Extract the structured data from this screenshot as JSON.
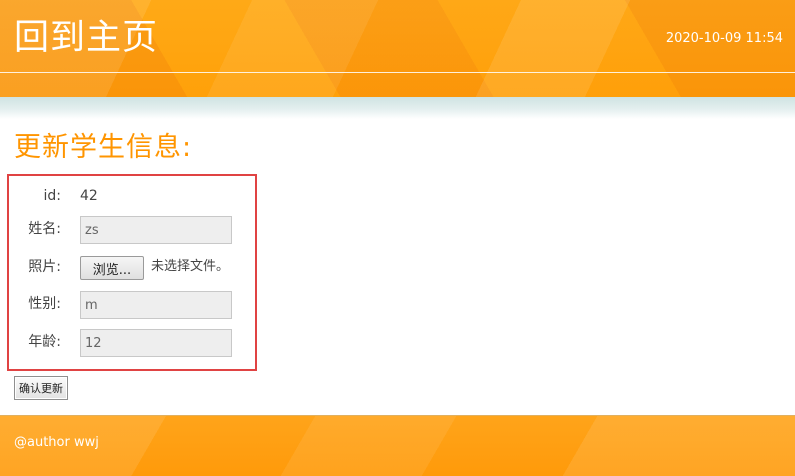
{
  "header": {
    "home_link": "回到主页",
    "datetime": "2020-10-09 11:54"
  },
  "page": {
    "title": "更新学生信息:"
  },
  "form": {
    "id_label": "id:",
    "id_value": "42",
    "name_label": "姓名:",
    "name_value": "zs",
    "photo_label": "照片:",
    "photo_button": "浏览...",
    "photo_status": "未选择文件。",
    "gender_label": "性别:",
    "gender_value": "m",
    "age_label": "年龄:",
    "age_value": "12",
    "submit_label": "确认更新"
  },
  "footer": {
    "author": "@author wwj"
  },
  "colors": {
    "banner": "#ff9b0a",
    "title": "#ff9500",
    "highlight_border": "#e04343"
  }
}
